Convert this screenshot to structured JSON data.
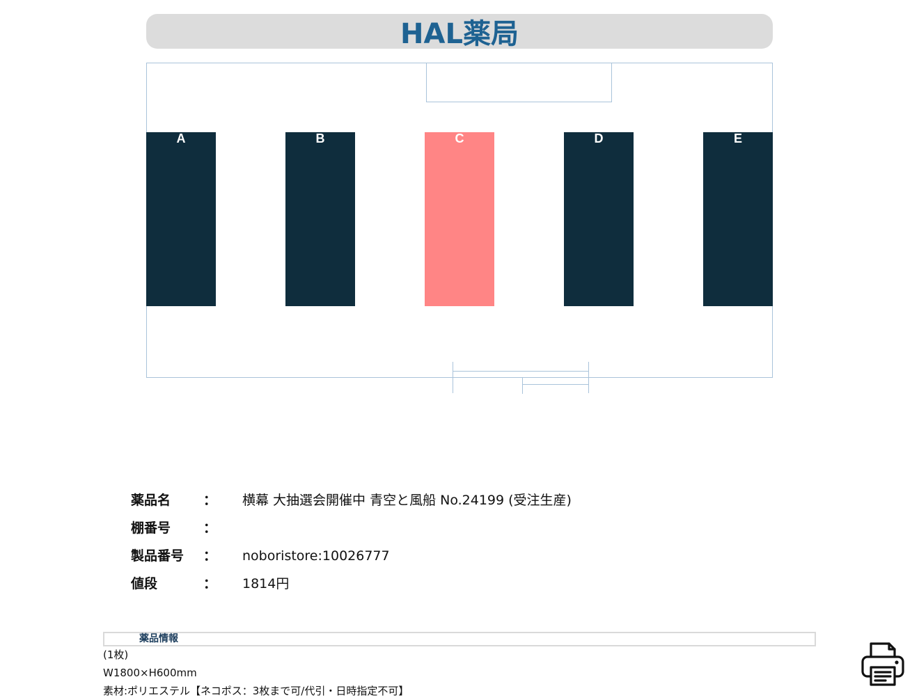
{
  "header": {
    "title": "HAL薬局"
  },
  "map": {
    "shelves": [
      {
        "label": "A",
        "highlighted": false
      },
      {
        "label": "B",
        "highlighted": false
      },
      {
        "label": "C",
        "highlighted": true
      },
      {
        "label": "D",
        "highlighted": false
      },
      {
        "label": "E",
        "highlighted": false
      }
    ],
    "colors": {
      "shelf": "#0f2d3d",
      "highlight": "#ff8585",
      "outline": "#a9c3da",
      "title": "#1e6292"
    }
  },
  "product": {
    "name_label": "薬品名",
    "name_value": "横幕 大抽選会開催中 青空と風船 No.24199 (受注生産)",
    "shelf_label": "棚番号",
    "shelf_value": "",
    "code_label": "製品番号",
    "code_value": "noboristore:10026777",
    "price_label": "値段",
    "price_value": "1814円",
    "colon": "："
  },
  "details": {
    "header": "薬品情報",
    "lines": [
      "(1枚)",
      "W1800×H600mm",
      "素材:ポリエステル【ネコポス：3枚まで可/代引・日時指定不可】"
    ]
  },
  "print": {
    "icon": "printer-icon"
  }
}
